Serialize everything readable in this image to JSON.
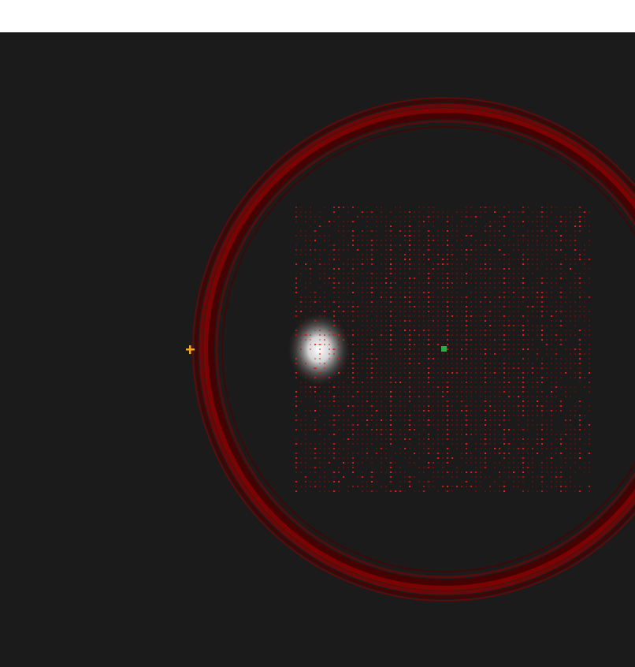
{
  "colors": {
    "top_bar": "#ffffff",
    "background": "#1b1b1b",
    "ring": "#8b0000",
    "ring_dark": "#4a0000",
    "particle": "#c40000",
    "particle_bright": "#ff1a1a",
    "glow": "#f2f2f2",
    "center_marker": "#2ea84a",
    "origin_marker": "#f5a623"
  },
  "icons": {
    "center_marker": "green-square-marker",
    "origin_marker": "orange-plus-marker"
  }
}
